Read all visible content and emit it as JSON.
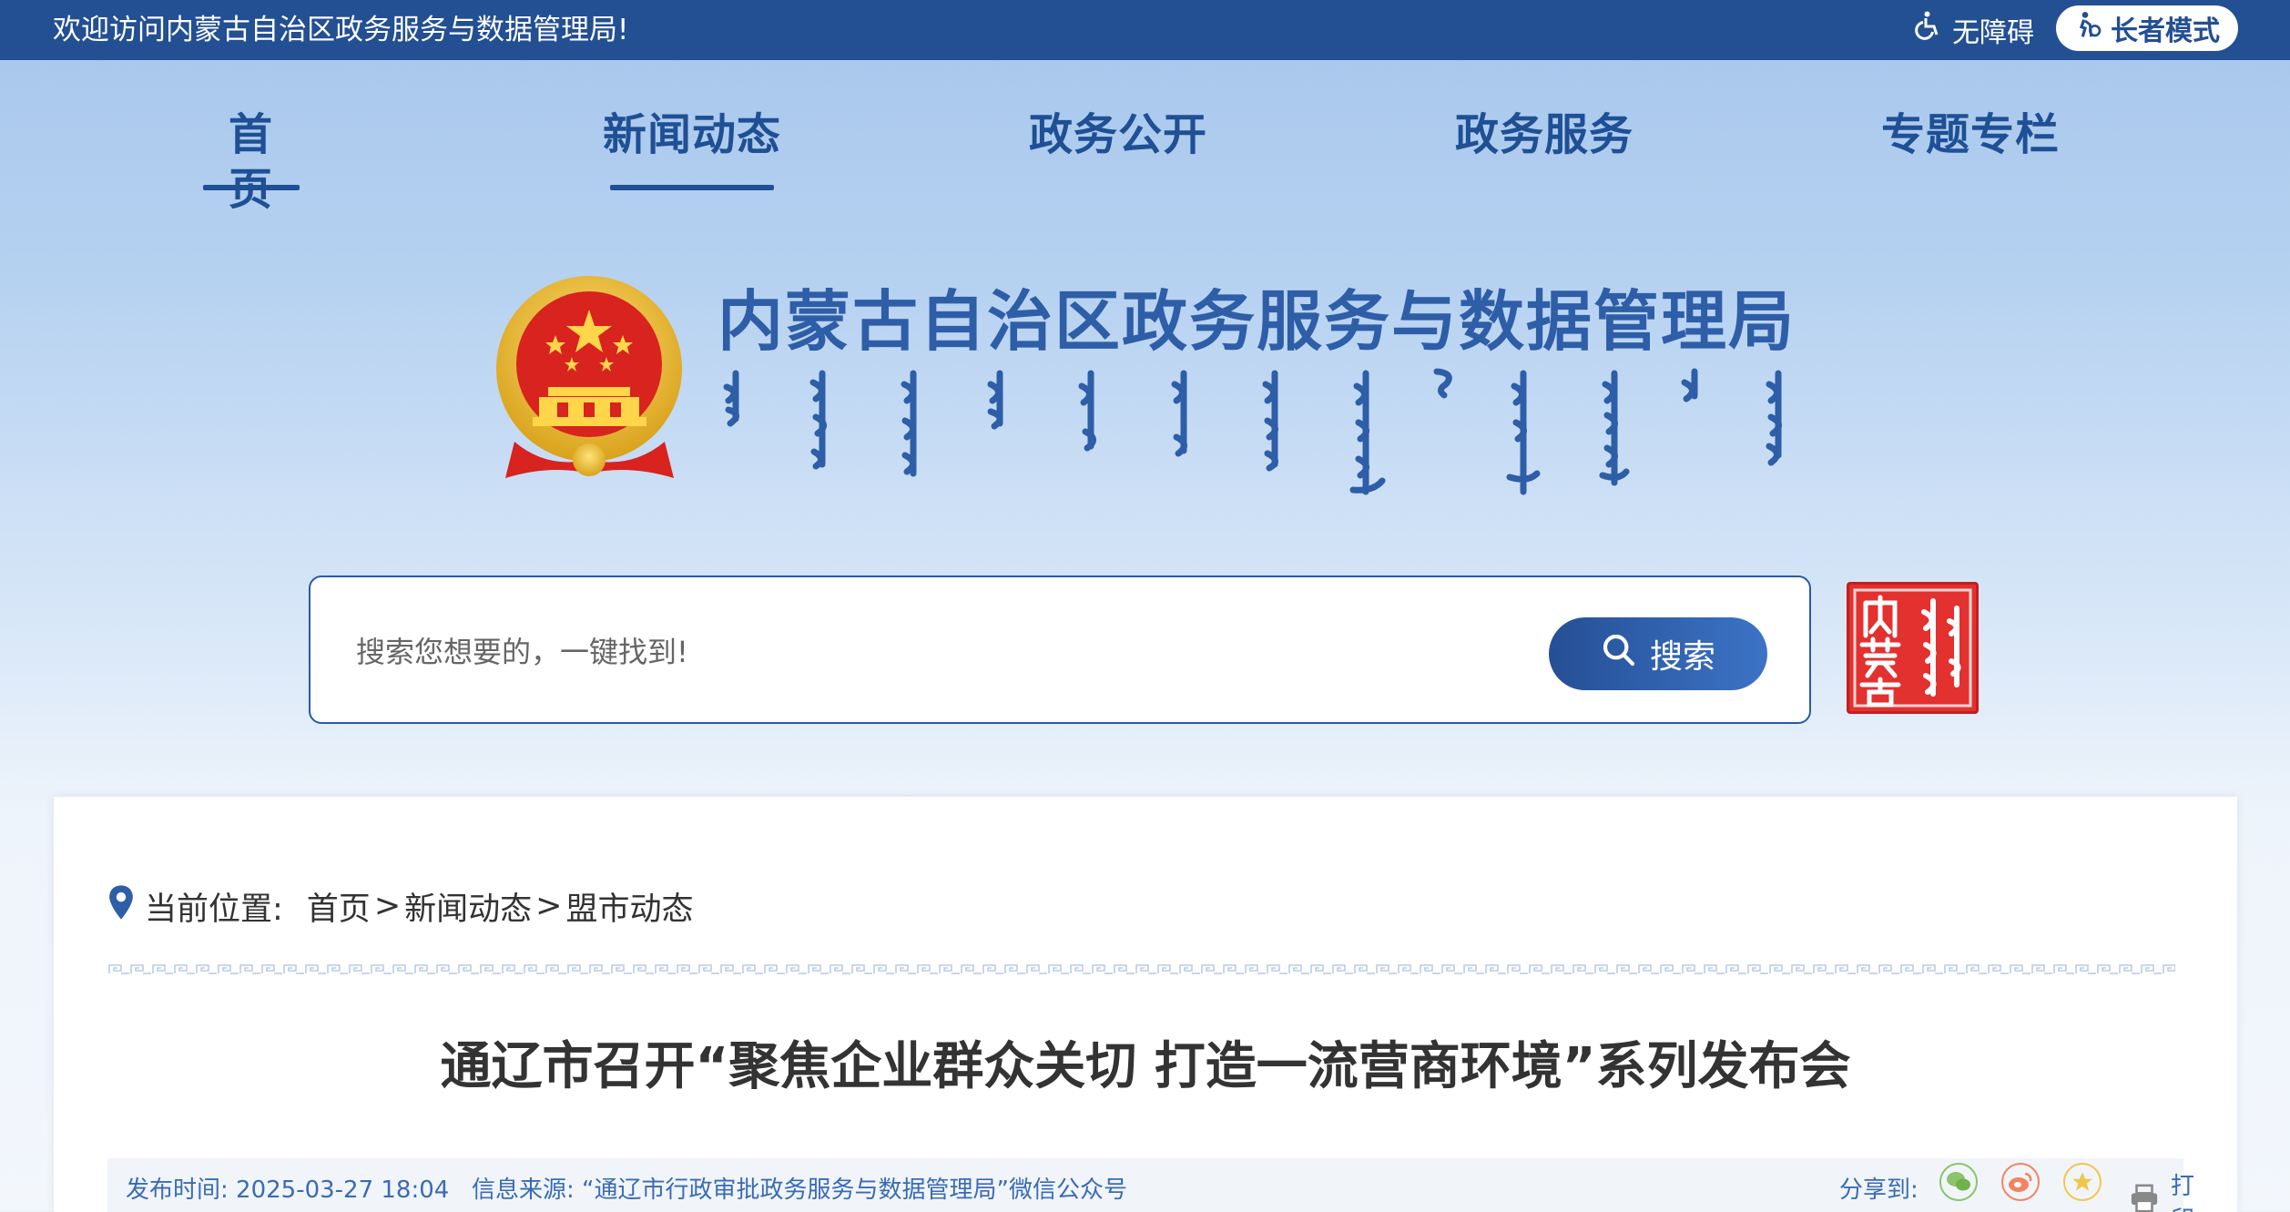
{
  "topbar": {
    "welcome": "欢迎访问内蒙古自治区政务服务与数据管理局!",
    "accessibility_label": "无障碍",
    "elder_mode_label": "长者模式"
  },
  "nav": {
    "items": [
      {
        "label": "首　页",
        "active": true
      },
      {
        "label": "新闻动态",
        "active": true
      },
      {
        "label": "政务公开",
        "active": false
      },
      {
        "label": "政务服务",
        "active": false
      },
      {
        "label": "专题专栏",
        "active": false
      }
    ]
  },
  "header": {
    "site_title": "内蒙古自治区政务服务与数据管理局"
  },
  "search": {
    "placeholder": "搜索您想要的，一键找到!",
    "button_label": "搜索"
  },
  "seal": {
    "text": "内蒙古"
  },
  "breadcrumb": {
    "label": "当前位置:",
    "items": [
      "首页",
      "新闻动态",
      "盟市动态"
    ],
    "separator": ">"
  },
  "article": {
    "title": "通辽市召开“聚焦企业群众关切 打造一流营商环境”系列发布会",
    "publish_time": "发布时间: 2025-03-27 18:04",
    "source": "信息来源: “通辽市行政审批政务服务与数据管理局”微信公众号",
    "share_label": "分享到:",
    "print_label": "打印"
  },
  "colors": {
    "primary": "#234f93",
    "accent_blue": "#2e5ea7",
    "seal_red": "#e2312f",
    "meta_text": "#3a6bb5"
  }
}
